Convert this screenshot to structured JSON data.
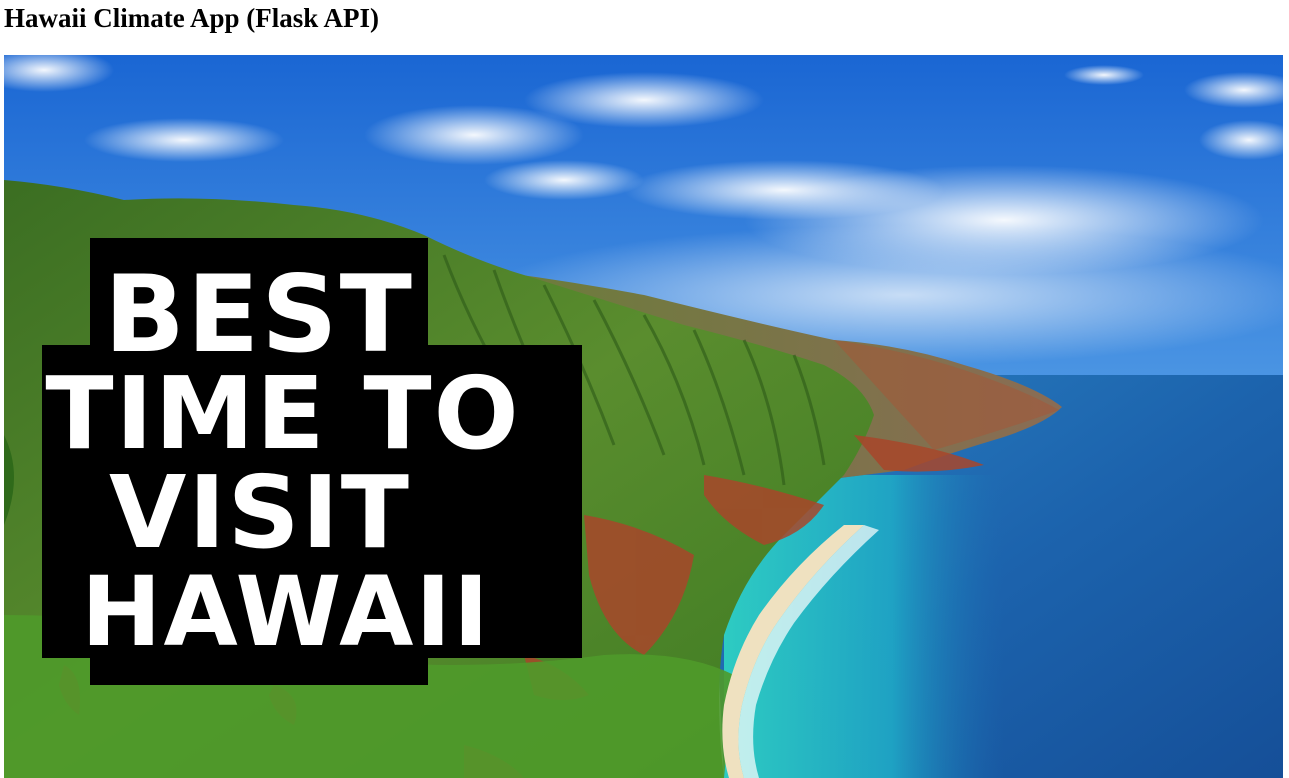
{
  "page": {
    "title": "Hawaii Climate App (Flask API)"
  },
  "hero": {
    "overlay_lines": [
      "BEST",
      "TIME TO",
      "VISIT",
      "HAWAII"
    ]
  },
  "colors": {
    "sky_top": "#1f6fd6",
    "sky_horizon": "#cfe3f4",
    "ocean_deep": "#1b5fae",
    "ocean_shallow": "#22c7c0",
    "cliff_green": "#4f8a2a",
    "cliff_red": "#a94a2c",
    "sand": "#efe1c0",
    "overlay_box": "#000000",
    "overlay_text": "#ffffff"
  }
}
